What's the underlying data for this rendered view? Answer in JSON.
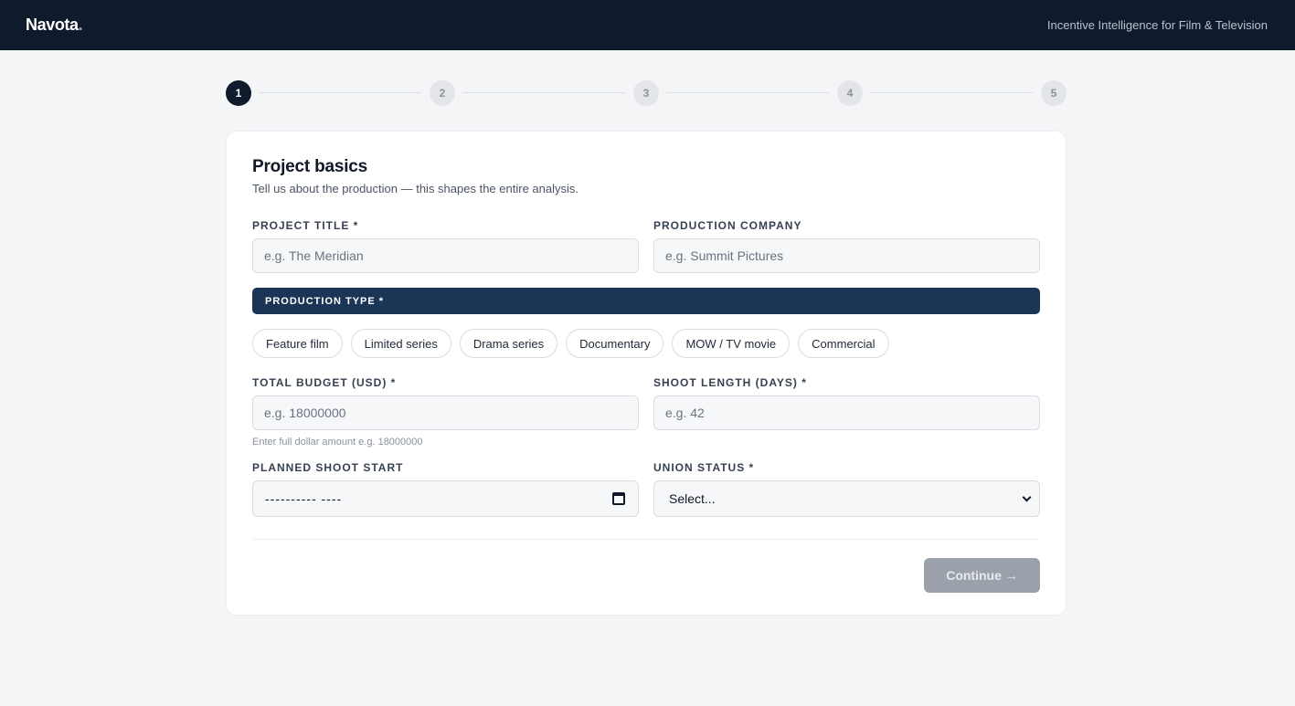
{
  "header": {
    "logo": "Navota",
    "logo_dot": ".",
    "tagline": "Incentive Intelligence for Film & Television"
  },
  "stepper": {
    "steps": [
      "1",
      "2",
      "3",
      "4",
      "5"
    ],
    "active_step": 1
  },
  "card": {
    "title": "Project basics",
    "subtitle": "Tell us about the production — this shapes the entire analysis."
  },
  "fields": {
    "project_title": {
      "label": "Project title *",
      "placeholder": "e.g. The Meridian"
    },
    "production_company": {
      "label": "Production company",
      "placeholder": "e.g. Summit Pictures"
    },
    "total_budget": {
      "label": "Total budget (USD) *",
      "placeholder": "e.g. 18000000",
      "hint": "Enter full dollar amount e.g. 18000000"
    },
    "shoot_length": {
      "label": "Shoot length (days) *",
      "placeholder": "e.g. 42"
    },
    "shoot_start": {
      "label": "Planned shoot start",
      "value": "----------  ----"
    },
    "union_status": {
      "label": "Union status *",
      "selected": "Select..."
    }
  },
  "production_type": {
    "label": "PRODUCTION TYPE *",
    "options": [
      "Feature film",
      "Limited series",
      "Drama series",
      "Documentary",
      "MOW / TV movie",
      "Commercial"
    ]
  },
  "actions": {
    "continue_label": "Continue →"
  },
  "colors": {
    "topbar": "#0f1b2d",
    "section_bar": "#1b3556",
    "disabled_button": "#9aa1ab"
  }
}
